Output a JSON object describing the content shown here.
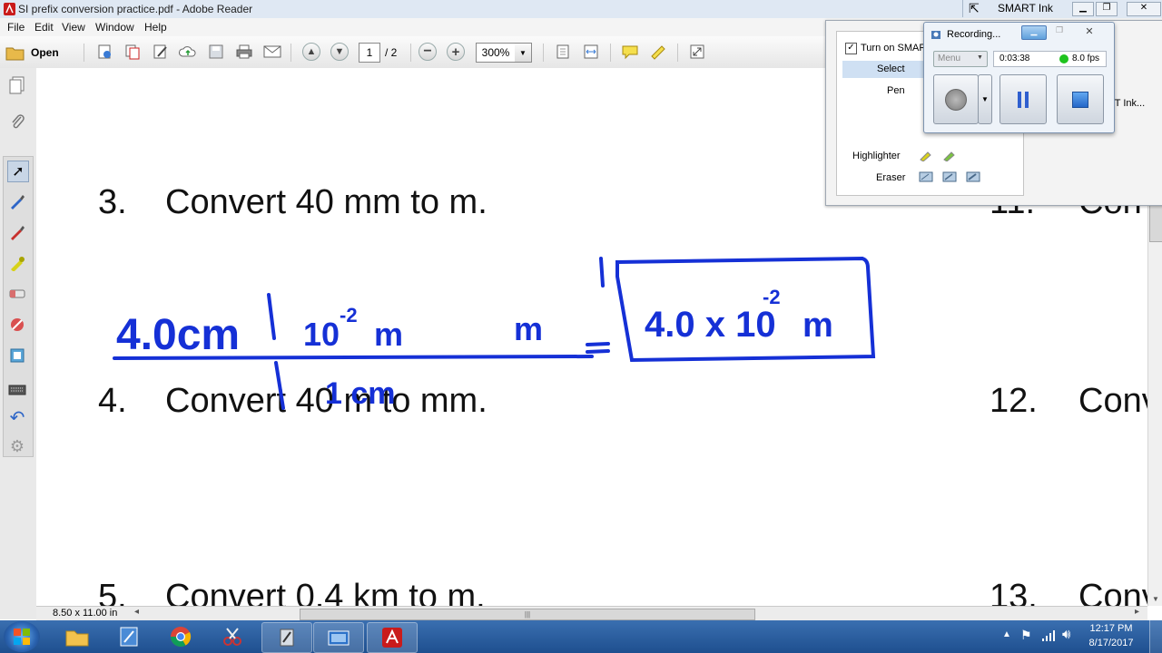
{
  "window": {
    "title": "SI prefix conversion practice.pdf - Adobe Reader"
  },
  "menubar": {
    "items": [
      "File",
      "Edit",
      "View",
      "Window",
      "Help"
    ]
  },
  "toolbar": {
    "open_label": "Open",
    "page_current": "1",
    "page_total": "/ 2",
    "zoom": "300%"
  },
  "document": {
    "questions": [
      {
        "number": "3.",
        "text": "Convert 40 mm to m."
      },
      {
        "number": "4.",
        "text": "Convert 40 m to mm."
      },
      {
        "number": "5.",
        "text": "Convert 0.4 km to m."
      }
    ],
    "right_column": [
      "11.",
      "Con",
      "12.",
      "Conv",
      "13.",
      "Conv"
    ],
    "handwriting": {
      "left_quantity": "4.0cm",
      "conversion_top": "10",
      "conversion_exp": "-2",
      "conversion_unit": "m",
      "conversion_bottom": "1 cm",
      "target_unit": "m",
      "equals": "=",
      "result_mantissa": "4.0 x 10",
      "result_exp": "-2",
      "result_unit": "m",
      "ink_color": "#1530d6"
    }
  },
  "statusbar": {
    "page_size": "8.50 x 11.00 in"
  },
  "smart_ink": {
    "title": "SMART Ink",
    "turn_on_label": "Turn on SMAR",
    "select_label": "Select",
    "pen_label": "Pen",
    "highlighter_label": "Highlighter",
    "eraser_label": "Eraser",
    "partial_text": "RT Ink..."
  },
  "recorder": {
    "title": "Recording...",
    "menu_label": "Menu",
    "time": "0:03:38",
    "fps": "8.0 fps"
  },
  "taskbar": {
    "time": "12:17 PM",
    "date": "8/17/2017"
  }
}
